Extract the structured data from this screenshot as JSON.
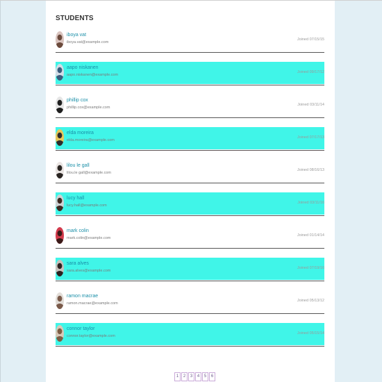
{
  "page": {
    "title": "STUDENTS"
  },
  "students": [
    {
      "name": "iboya vat",
      "email": "iboya.vat@example.com",
      "joined": "Joined 07/15/15",
      "highlight": false,
      "avatar_bg": "#d9c4bf",
      "avatar_fg": "#6b4a3c"
    },
    {
      "name": "aapo niskanen",
      "email": "aapo.niskanen@example.com",
      "joined": "Joined 09/17/12",
      "highlight": true,
      "avatar_bg": "#d4dde6",
      "avatar_fg": "#3a5d7c"
    },
    {
      "name": "phillip cox",
      "email": "phillip.cox@example.com",
      "joined": "Joined 03/11/14",
      "highlight": false,
      "avatar_bg": "#e6e6e6",
      "avatar_fg": "#1f1f1f"
    },
    {
      "name": "elda moreira",
      "email": "elda.moreira@example.com",
      "joined": "Joined 07/17/13",
      "highlight": true,
      "avatar_bg": "#e8c65a",
      "avatar_fg": "#2c2c2c"
    },
    {
      "name": "lilou le gall",
      "email": "lilou.le gall@example.com",
      "joined": "Joined 08/16/13",
      "highlight": false,
      "avatar_bg": "#e9e4e2",
      "avatar_fg": "#2a2522"
    },
    {
      "name": "lucy hall",
      "email": "lucy.hall@example.com",
      "joined": "Joined 03/11/16",
      "highlight": true,
      "avatar_bg": "#cfd2d4",
      "avatar_fg": "#3d2a22"
    },
    {
      "name": "mark colin",
      "email": "mark.colin@example.com",
      "joined": "Joined 01/14/14",
      "highlight": false,
      "avatar_bg": "#d23a4c",
      "avatar_fg": "#3a1a18"
    },
    {
      "name": "sara alves",
      "email": "sara.alves@example.com",
      "joined": "Joined 07/19/16",
      "highlight": true,
      "avatar_bg": "#c7c2bd",
      "avatar_fg": "#2a2220"
    },
    {
      "name": "ramon macrae",
      "email": "ramon.macrae@example.com",
      "joined": "Joined 05/13/12",
      "highlight": false,
      "avatar_bg": "#e2ddd8",
      "avatar_fg": "#7a5a4a"
    },
    {
      "name": "connor taylor",
      "email": "connor.taylor@example.com",
      "joined": "Joined 05/15/14",
      "highlight": true,
      "avatar_bg": "#d8c9b8",
      "avatar_fg": "#7d5e45"
    }
  ],
  "pagination": {
    "pages": [
      "1",
      "2",
      "3",
      "4",
      "5",
      "6"
    ]
  }
}
